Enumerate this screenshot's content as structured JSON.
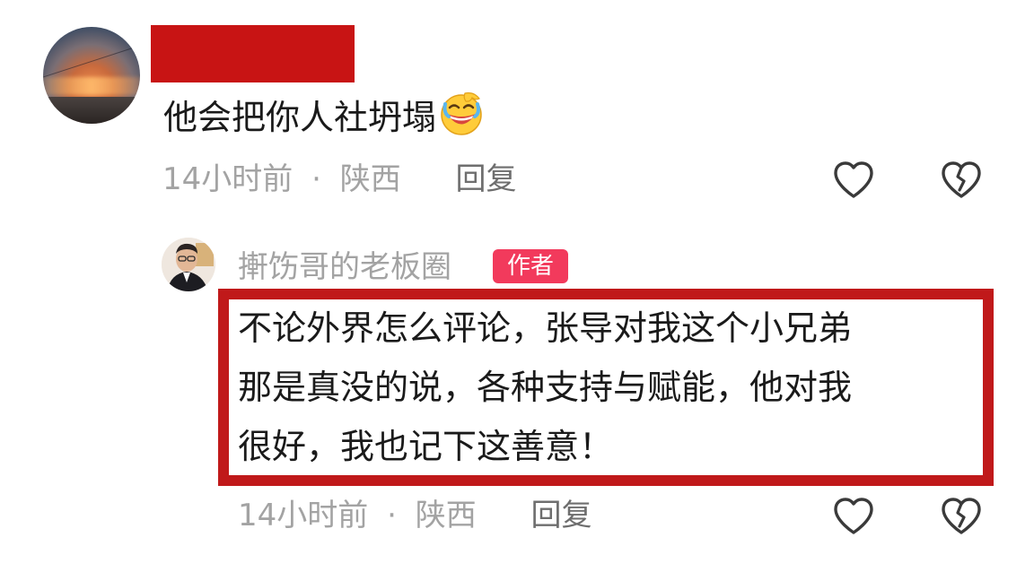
{
  "comment": {
    "text": "他会把你人社坍塌",
    "emoji": "laughing-crying-emoji",
    "time": "14小时前",
    "separator": "·",
    "location": "陕西",
    "reply_label": "回复"
  },
  "reply": {
    "username": "搟饬哥的老板圈",
    "badge": "作者",
    "lines": [
      "不论外界怎么评论，张导对我这个小兄弟",
      "那是真没的说，各种支持与赋能，他对我",
      "很好，我也记下这善意！"
    ],
    "time": "14小时前",
    "separator": "·",
    "location": "陕西",
    "reply_label": "回复"
  },
  "icons": {
    "like": "heart-outline-icon",
    "dislike": "broken-heart-icon"
  },
  "colors": {
    "redaction": "#c81414",
    "highlight_border": "#c0191a",
    "author_badge": "#f23a5c",
    "meta_text": "#a3a3a3"
  }
}
